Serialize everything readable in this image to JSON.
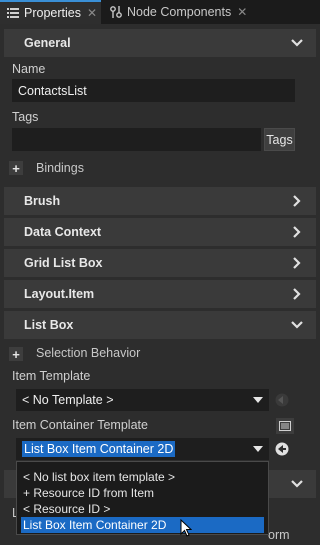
{
  "tabs": [
    {
      "label": "Properties",
      "close": "✕"
    },
    {
      "label": "Node Components",
      "close": "✕"
    }
  ],
  "sections": {
    "general": "General",
    "brush": "Brush",
    "data_context": "Data Context",
    "grid_list_box": "Grid List Box",
    "layout_item": "Layout.Item",
    "list_box": "List Box"
  },
  "general": {
    "name_label": "Name",
    "name_value": "ContactsList",
    "tags_label": "Tags",
    "tags_value": "",
    "tags_button": "Tags",
    "bindings_label": "Bindings"
  },
  "list_box": {
    "selection_behavior_label": "Selection Behavior",
    "item_template_label": "Item Template",
    "item_template_value": "< No Template >",
    "item_container_template_label": "Item Container Template",
    "item_container_template_value": "List Box Item Container 2D",
    "partial_label_1": "L",
    "partial_label_2": "orm"
  },
  "popup_options": [
    "< No list box item template >",
    "+ Resource ID from Item",
    "< Resource ID >",
    "List Box Item Container 2D"
  ],
  "popup_selected_index": 3,
  "colors": {
    "accent": "#1b6ac4",
    "tab_accent": "#3a8fd6"
  },
  "icons": [
    "properties-icon",
    "node-components-icon",
    "chevron-down-icon",
    "chevron-right-icon",
    "plus-icon",
    "reset-arrow-icon",
    "resource-browser-icon",
    "mouse-cursor-icon"
  ]
}
